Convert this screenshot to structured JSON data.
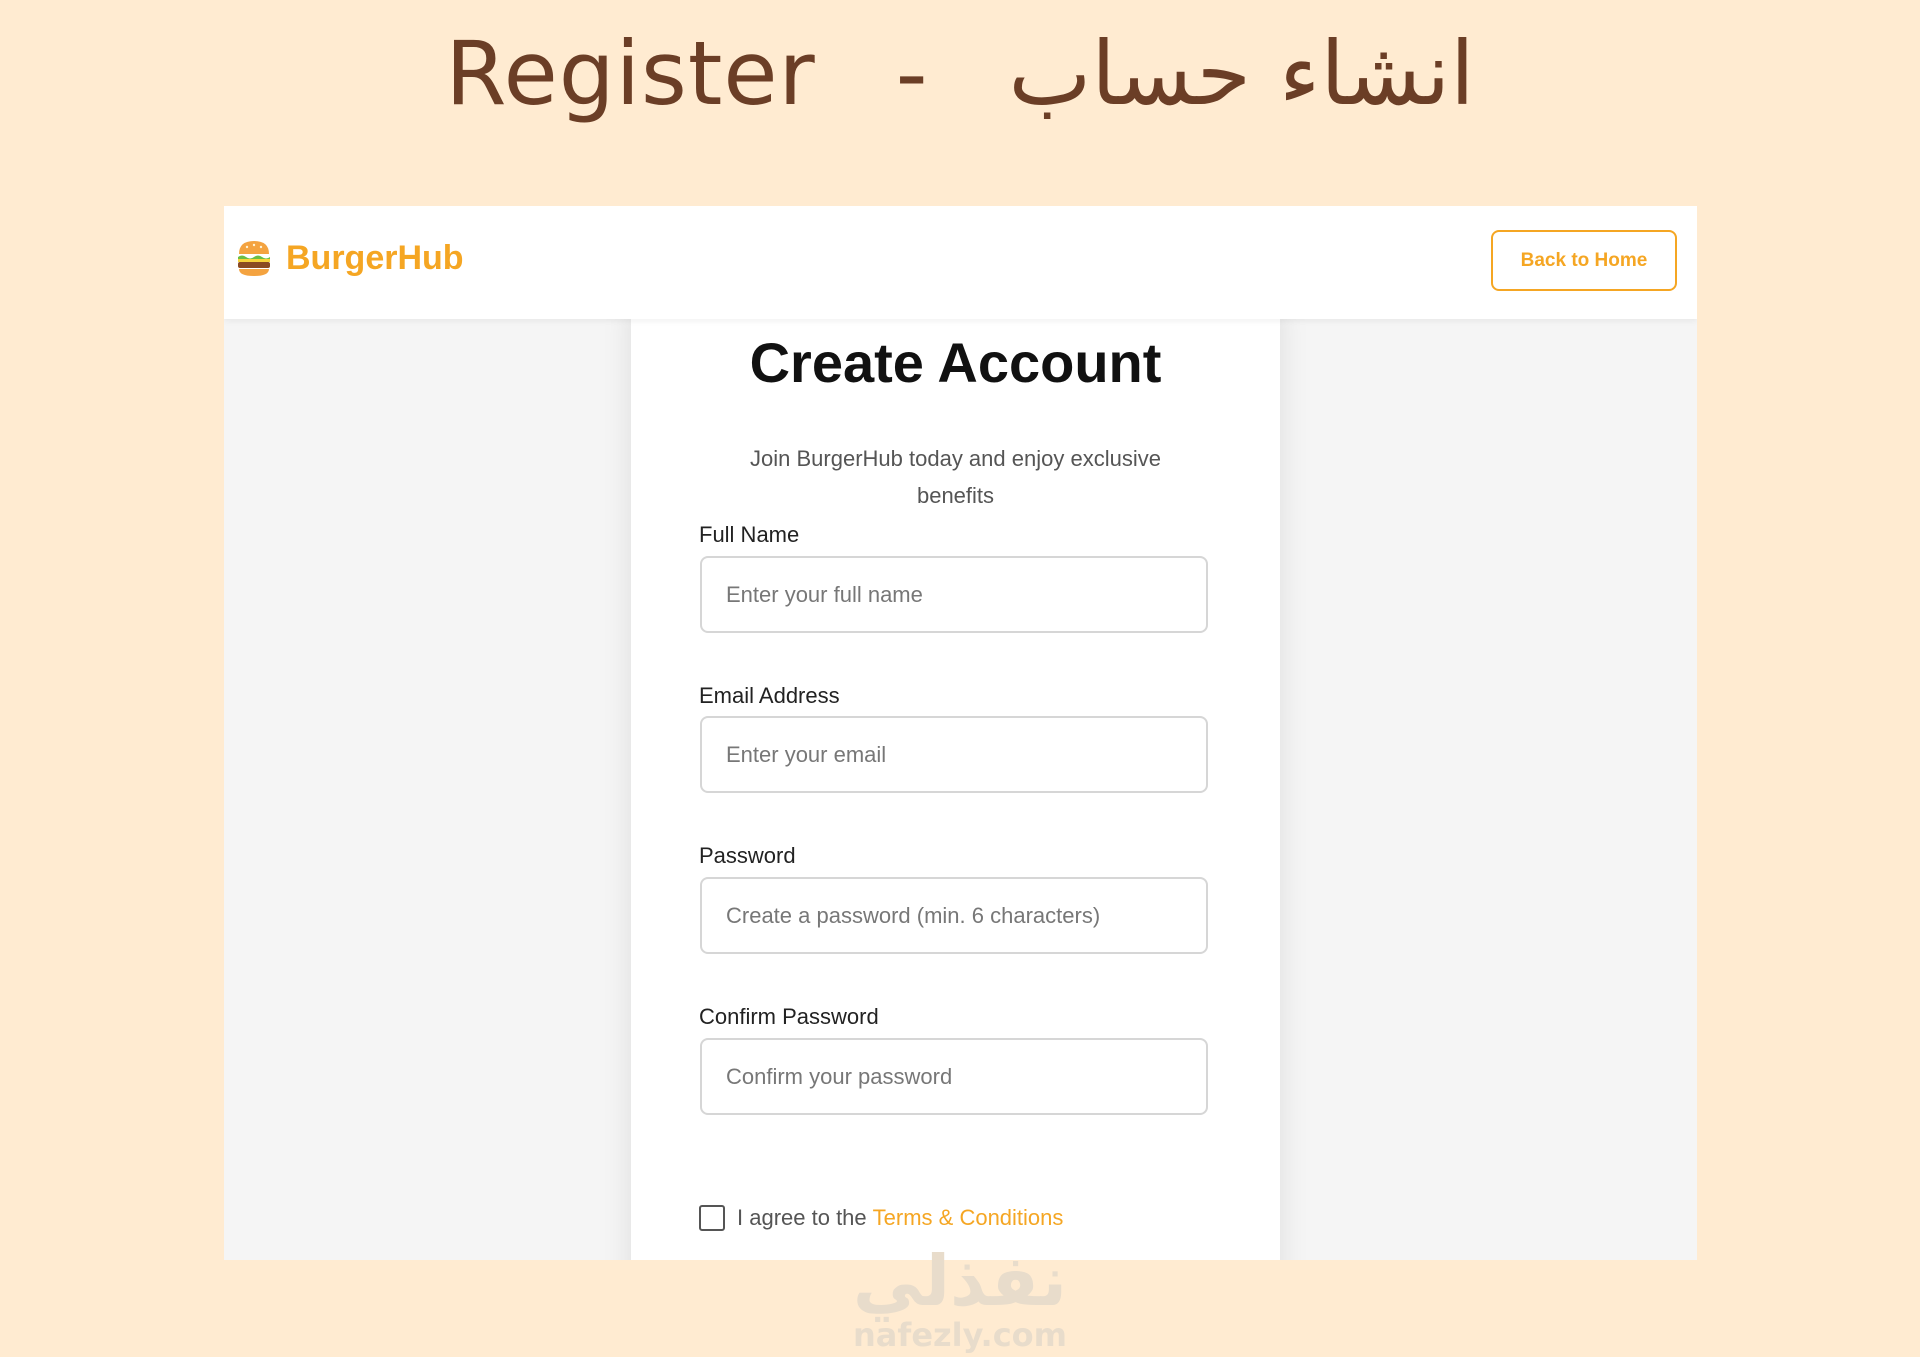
{
  "banner": {
    "title_en": "Register",
    "separator": "-",
    "title_ar": "انشاء حساب"
  },
  "navbar": {
    "brand_icon": "burger-icon",
    "brand_name": "BurgerHub",
    "back_button": "Back to Home"
  },
  "form": {
    "title": "Create Account",
    "subtitle": "Join BurgerHub today and enjoy exclusive benefits",
    "fields": [
      {
        "label": "Full Name",
        "placeholder": "Enter your full name"
      },
      {
        "label": "Email Address",
        "placeholder": "Enter your email"
      },
      {
        "label": "Password",
        "placeholder": "Create a password (min. 6 characters)"
      },
      {
        "label": "Confirm Password",
        "placeholder": "Confirm your password"
      }
    ],
    "terms_text": "I agree to the",
    "terms_link": "Terms & Conditions"
  },
  "watermark": {
    "arabic": "نفذلي",
    "latin": "nafezly.com"
  },
  "colors": {
    "background": "#FFEBD1",
    "banner_text": "#6B3E26",
    "accent": "#F5A623"
  }
}
